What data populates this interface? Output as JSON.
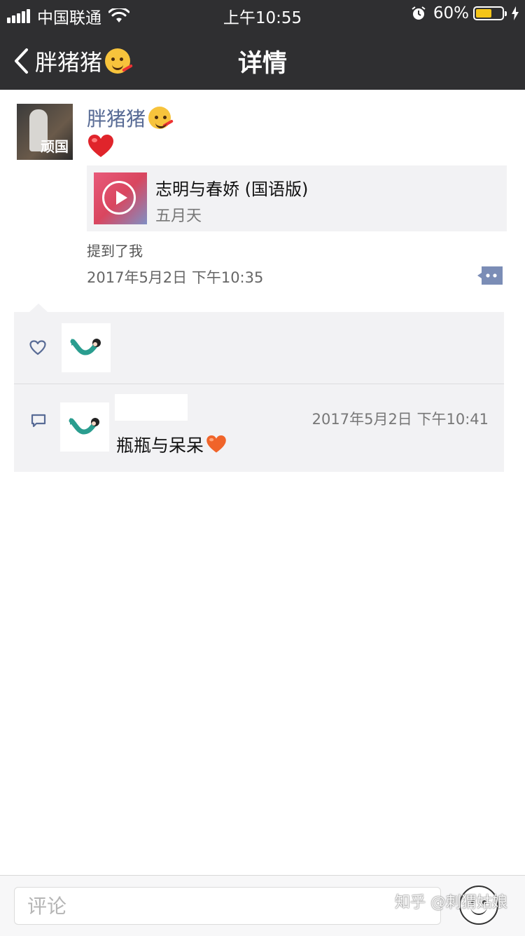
{
  "status_bar": {
    "carrier": "中国联通",
    "time": "上午10:55",
    "battery_percent": "60%",
    "battery_level": 0.6,
    "icons": [
      "signal-icon",
      "wifi-icon",
      "alarm-icon",
      "battery-icon",
      "charging-bolt-icon"
    ]
  },
  "nav": {
    "back_label": "胖猪猪",
    "title": "详情"
  },
  "post": {
    "author": "胖猪猪",
    "content_emoji": "heart-emoji",
    "share": {
      "song": "志明与春娇 (国语版)",
      "artist": "五月天"
    },
    "mention": "提到了我",
    "time": "2017年5月2日 下午10:35"
  },
  "likes": {
    "icon": "heart-outline-icon",
    "count": 1
  },
  "comments": [
    {
      "time": "2017年5月2日 下午10:41",
      "text": "瓶瓶与呆呆",
      "emoji": "orange-heart-emoji"
    }
  ],
  "comment_bar": {
    "placeholder": "评论"
  },
  "watermark": "知乎 @刺猬姑娘",
  "colors": {
    "nav_bg": "#2f2f31",
    "name_link": "#586b95",
    "panel_bg": "#f2f2f4",
    "battery": "#f5c518"
  }
}
